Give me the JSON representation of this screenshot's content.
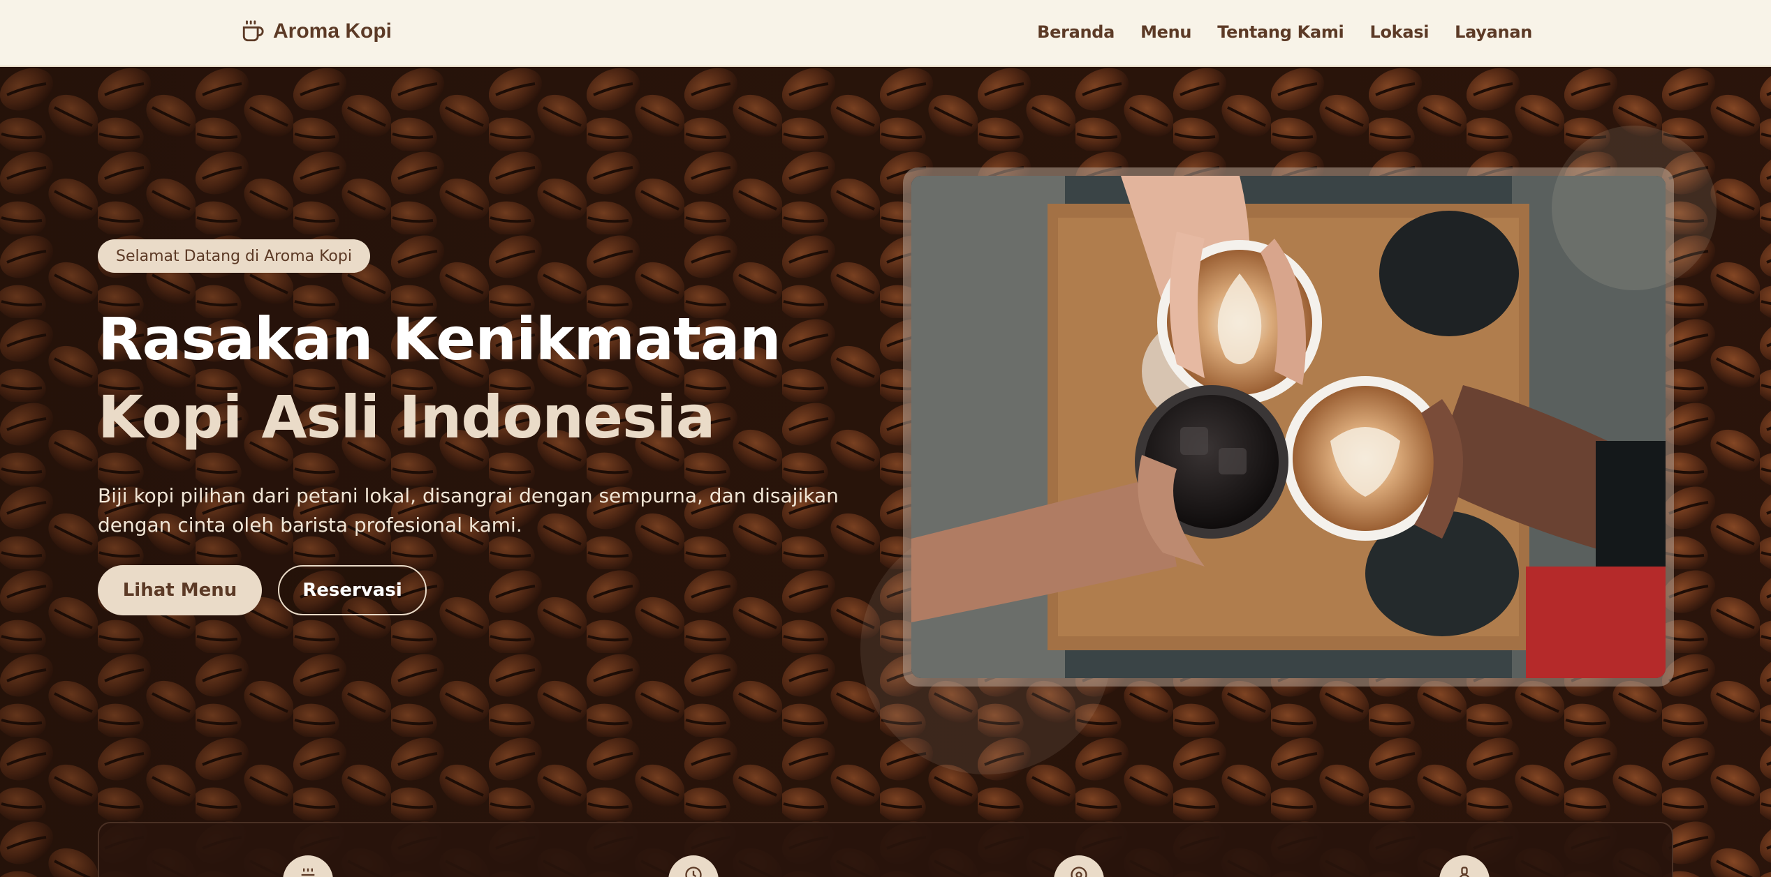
{
  "brand": {
    "name": "Aroma Kopi",
    "icon": "coffee-cup-icon"
  },
  "nav": {
    "items": [
      {
        "label": "Beranda"
      },
      {
        "label": "Menu"
      },
      {
        "label": "Tentang Kami"
      },
      {
        "label": "Lokasi"
      },
      {
        "label": "Layanan"
      }
    ]
  },
  "hero": {
    "badge": "Selamat Datang di Aroma Kopi",
    "headline_main": "Rasakan Kenikmatan ",
    "headline_accent": "Kopi Asli Indonesia",
    "subtitle": "Biji kopi pilihan dari petani lokal, disangrai dengan sempurna, dan disajikan dengan cinta oleh barista profesional kami.",
    "primary_button": "Lihat Menu",
    "secondary_button": "Reservasi"
  },
  "features": {
    "icons": [
      "coffee-bean-icon",
      "clock-icon",
      "location-icon",
      "service-icon"
    ]
  },
  "colors": {
    "cream": "#f8f3e8",
    "latte": "#eadbc8",
    "brown": "#5c3a26",
    "dark_roast": "#2a170f"
  }
}
